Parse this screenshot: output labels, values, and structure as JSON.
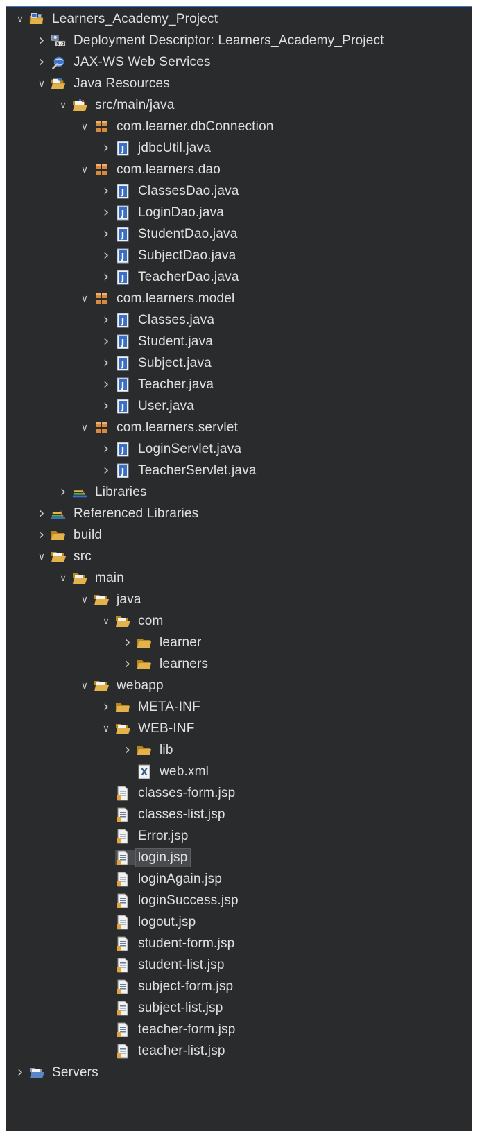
{
  "colors": {
    "background": "#2a2b2d",
    "text": "#e0e0e0",
    "twisty": "#c8c8c8",
    "focus_border": "#3874c7",
    "selection": "#4a4b4e",
    "folder": "#e3b24a",
    "package": "#d88a3c",
    "java_file": "#3a6fc4"
  },
  "tree": [
    {
      "label": "Learners_Academy_Project",
      "depth": 0,
      "twisty": "expanded",
      "icon": "project-icon"
    },
    {
      "label": "Deployment Descriptor: Learners_Academy_Project",
      "depth": 1,
      "twisty": "collapsed",
      "icon": "deployment-descriptor-icon"
    },
    {
      "label": "JAX-WS Web Services",
      "depth": 1,
      "twisty": "collapsed",
      "icon": "web-services-icon"
    },
    {
      "label": "Java Resources",
      "depth": 1,
      "twisty": "expanded",
      "icon": "java-resources-icon"
    },
    {
      "label": "src/main/java",
      "depth": 2,
      "twisty": "expanded",
      "icon": "source-folder-icon"
    },
    {
      "label": "com.learner.dbConnection",
      "depth": 3,
      "twisty": "expanded",
      "icon": "package-icon"
    },
    {
      "label": "jdbcUtil.java",
      "depth": 4,
      "twisty": "collapsed",
      "icon": "java-file-icon"
    },
    {
      "label": "com.learners.dao",
      "depth": 3,
      "twisty": "expanded",
      "icon": "package-icon"
    },
    {
      "label": "ClassesDao.java",
      "depth": 4,
      "twisty": "collapsed",
      "icon": "java-file-icon"
    },
    {
      "label": "LoginDao.java",
      "depth": 4,
      "twisty": "collapsed",
      "icon": "java-file-icon"
    },
    {
      "label": "StudentDao.java",
      "depth": 4,
      "twisty": "collapsed",
      "icon": "java-file-icon"
    },
    {
      "label": "SubjectDao.java",
      "depth": 4,
      "twisty": "collapsed",
      "icon": "java-file-icon"
    },
    {
      "label": "TeacherDao.java",
      "depth": 4,
      "twisty": "collapsed",
      "icon": "java-file-icon"
    },
    {
      "label": "com.learners.model",
      "depth": 3,
      "twisty": "expanded",
      "icon": "package-icon"
    },
    {
      "label": "Classes.java",
      "depth": 4,
      "twisty": "collapsed",
      "icon": "java-file-icon"
    },
    {
      "label": "Student.java",
      "depth": 4,
      "twisty": "collapsed",
      "icon": "java-file-icon"
    },
    {
      "label": "Subject.java",
      "depth": 4,
      "twisty": "collapsed",
      "icon": "java-file-icon"
    },
    {
      "label": "Teacher.java",
      "depth": 4,
      "twisty": "collapsed",
      "icon": "java-file-icon"
    },
    {
      "label": "User.java",
      "depth": 4,
      "twisty": "collapsed",
      "icon": "java-file-icon"
    },
    {
      "label": "com.learners.servlet",
      "depth": 3,
      "twisty": "expanded",
      "icon": "package-icon"
    },
    {
      "label": "LoginServlet.java",
      "depth": 4,
      "twisty": "collapsed",
      "icon": "java-file-icon"
    },
    {
      "label": "TeacherServlet.java",
      "depth": 4,
      "twisty": "collapsed",
      "icon": "java-file-icon"
    },
    {
      "label": "Libraries",
      "depth": 2,
      "twisty": "collapsed",
      "icon": "library-icon"
    },
    {
      "label": "Referenced Libraries",
      "depth": 1,
      "twisty": "collapsed",
      "icon": "library-icon"
    },
    {
      "label": "build",
      "depth": 1,
      "twisty": "collapsed",
      "icon": "folder-icon"
    },
    {
      "label": "src",
      "depth": 1,
      "twisty": "expanded",
      "icon": "open-folder-icon"
    },
    {
      "label": "main",
      "depth": 2,
      "twisty": "expanded",
      "icon": "open-folder-icon"
    },
    {
      "label": "java",
      "depth": 3,
      "twisty": "expanded",
      "icon": "open-folder-icon"
    },
    {
      "label": "com",
      "depth": 4,
      "twisty": "expanded",
      "icon": "open-folder-icon"
    },
    {
      "label": "learner",
      "depth": 5,
      "twisty": "collapsed",
      "icon": "folder-icon"
    },
    {
      "label": "learners",
      "depth": 5,
      "twisty": "collapsed",
      "icon": "folder-icon"
    },
    {
      "label": "webapp",
      "depth": 3,
      "twisty": "expanded",
      "icon": "open-folder-icon"
    },
    {
      "label": "META-INF",
      "depth": 4,
      "twisty": "collapsed",
      "icon": "folder-icon"
    },
    {
      "label": "WEB-INF",
      "depth": 4,
      "twisty": "expanded",
      "icon": "open-folder-icon"
    },
    {
      "label": "lib",
      "depth": 5,
      "twisty": "collapsed",
      "icon": "folder-icon"
    },
    {
      "label": "web.xml",
      "depth": 5,
      "twisty": "none",
      "icon": "xml-file-icon"
    },
    {
      "label": "classes-form.jsp",
      "depth": 4,
      "twisty": "none",
      "icon": "jsp-file-icon"
    },
    {
      "label": "classes-list.jsp",
      "depth": 4,
      "twisty": "none",
      "icon": "jsp-file-icon"
    },
    {
      "label": "Error.jsp",
      "depth": 4,
      "twisty": "none",
      "icon": "jsp-file-icon"
    },
    {
      "label": "login.jsp",
      "depth": 4,
      "twisty": "none",
      "icon": "jsp-file-icon",
      "selected": true
    },
    {
      "label": "loginAgain.jsp",
      "depth": 4,
      "twisty": "none",
      "icon": "jsp-file-icon"
    },
    {
      "label": "loginSuccess.jsp",
      "depth": 4,
      "twisty": "none",
      "icon": "jsp-file-icon"
    },
    {
      "label": "logout.jsp",
      "depth": 4,
      "twisty": "none",
      "icon": "jsp-file-icon"
    },
    {
      "label": "student-form.jsp",
      "depth": 4,
      "twisty": "none",
      "icon": "jsp-file-icon"
    },
    {
      "label": "student-list.jsp",
      "depth": 4,
      "twisty": "none",
      "icon": "jsp-file-icon"
    },
    {
      "label": "subject-form.jsp",
      "depth": 4,
      "twisty": "none",
      "icon": "jsp-file-icon"
    },
    {
      "label": "subject-list.jsp",
      "depth": 4,
      "twisty": "none",
      "icon": "jsp-file-icon"
    },
    {
      "label": "teacher-form.jsp",
      "depth": 4,
      "twisty": "none",
      "icon": "jsp-file-icon"
    },
    {
      "label": "teacher-list.jsp",
      "depth": 4,
      "twisty": "none",
      "icon": "jsp-file-icon"
    },
    {
      "label": "Servers",
      "depth": 0,
      "twisty": "collapsed",
      "icon": "servers-folder-icon"
    }
  ]
}
